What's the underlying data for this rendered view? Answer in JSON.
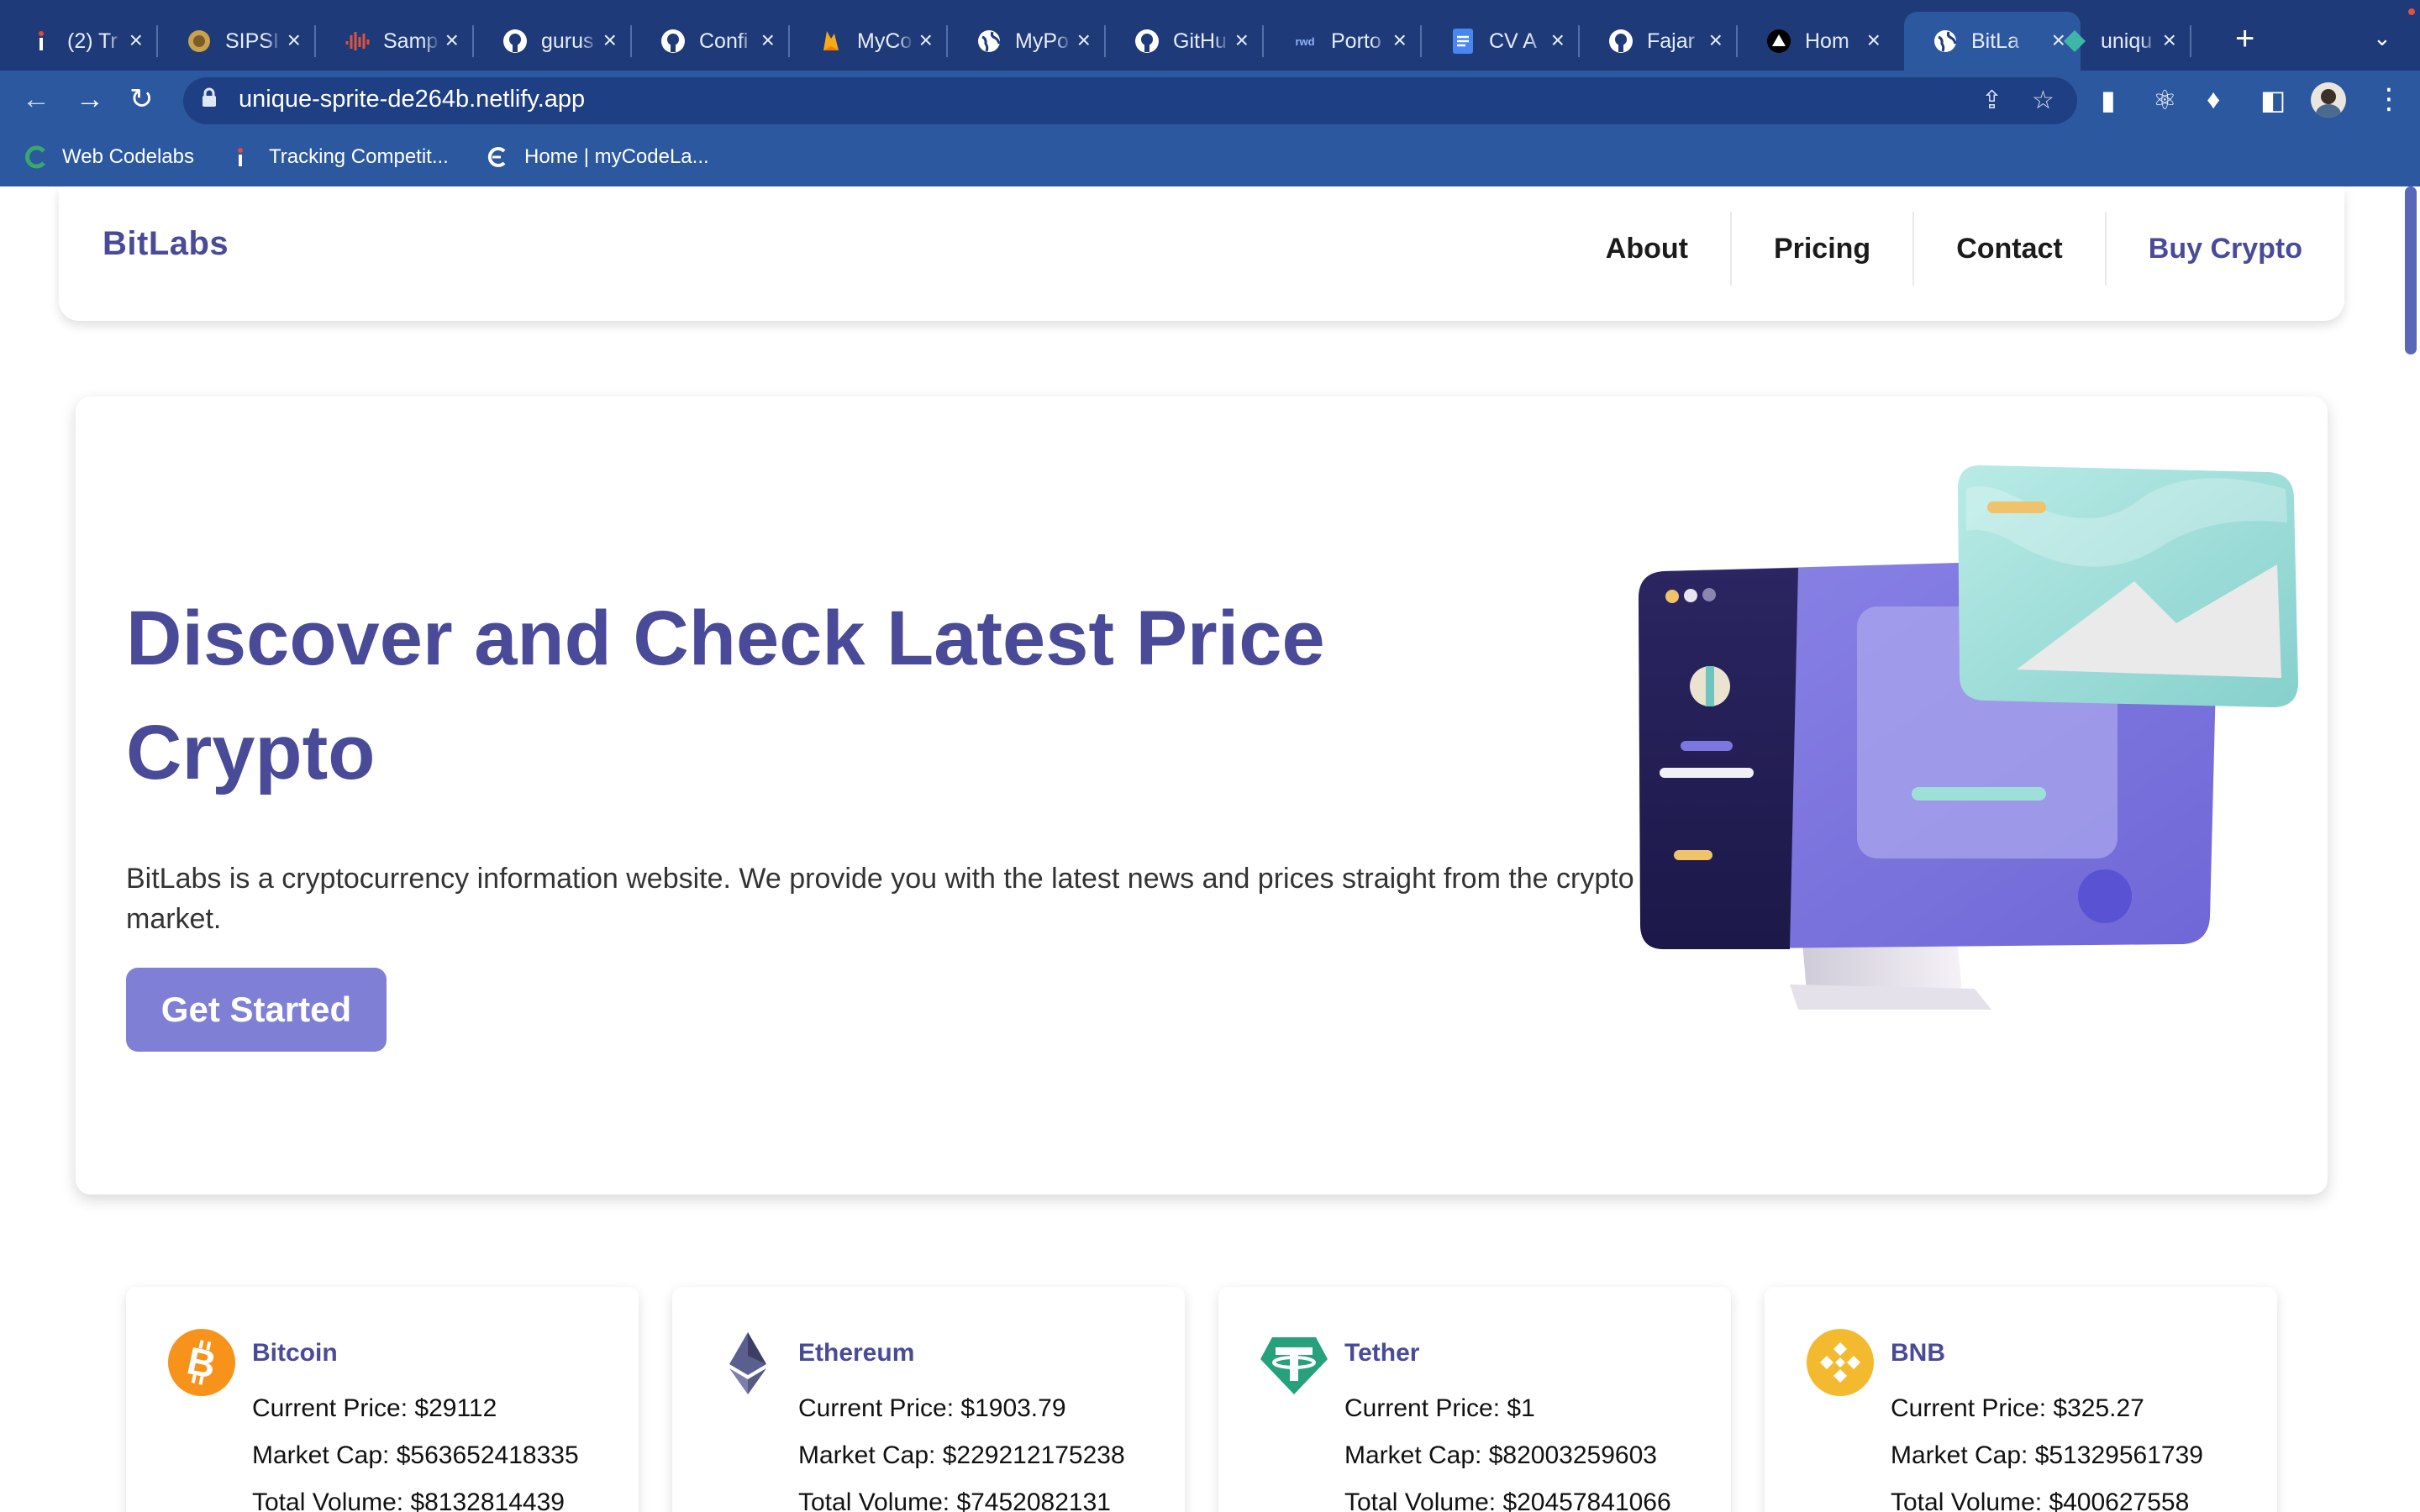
{
  "browser": {
    "tabs": [
      {
        "title": "(2) Tr",
        "icon": "tracking-icon"
      },
      {
        "title": "SIPSI",
        "icon": "emblem-icon"
      },
      {
        "title": "Samp",
        "icon": "waveform-icon"
      },
      {
        "title": "gurus",
        "icon": "github-icon"
      },
      {
        "title": "Confi",
        "icon": "github-icon"
      },
      {
        "title": "MyCo",
        "icon": "firebase-icon"
      },
      {
        "title": "MyPo",
        "icon": "globe-icon"
      },
      {
        "title": "GitHu",
        "icon": "github-icon"
      },
      {
        "title": "Porto",
        "icon": "rwd-icon"
      },
      {
        "title": "CV A",
        "icon": "docs-icon"
      },
      {
        "title": "Fajar",
        "icon": "github-icon"
      },
      {
        "title": "Hom",
        "icon": "vercel-icon"
      },
      {
        "title": "BitLa",
        "icon": "globe-icon",
        "active": true
      },
      {
        "title": "uniqu",
        "icon": "netlify-icon"
      }
    ],
    "rwd_label": "rwd",
    "url": "unique-sprite-de264b.netlify.app",
    "bookmarks": [
      {
        "label": "Web Codelabs",
        "icon": "codelabs-icon"
      },
      {
        "label": "Tracking Competit...",
        "icon": "tracking-icon"
      },
      {
        "label": "Home | myCodeLa...",
        "icon": "mycodelabs-icon"
      }
    ]
  },
  "site": {
    "brand": "BitLabs",
    "nav": [
      "About",
      "Pricing",
      "Contact",
      "Buy Crypto"
    ],
    "hero": {
      "title": "Discover and Check Latest Price Crypto",
      "description": "BitLabs is a cryptocurrency information website. We provide you with the latest news and prices straight from the crypto market.",
      "cta": "Get Started"
    },
    "coins": [
      {
        "name": "Bitcoin",
        "icon": "bitcoin-icon",
        "color": "#f7931a",
        "price": "Current Price: $29112",
        "market_cap": "Market Cap: $563652418335",
        "volume": "Total Volume: $8132814439"
      },
      {
        "name": "Ethereum",
        "icon": "ethereum-icon",
        "color": "#627eea",
        "price": "Current Price: $1903.79",
        "market_cap": "Market Cap: $229212175238",
        "volume": "Total Volume: $7452082131"
      },
      {
        "name": "Tether",
        "icon": "tether-icon",
        "color": "#26a17b",
        "price": "Current Price: $1",
        "market_cap": "Market Cap: $82003259603",
        "volume": "Total Volume: $20457841066"
      },
      {
        "name": "BNB",
        "icon": "bnb-icon",
        "color": "#f3ba2f",
        "price": "Current Price: $325.27",
        "market_cap": "Market Cap: $51329561739",
        "volume": "Total Volume: $400627558"
      }
    ]
  }
}
